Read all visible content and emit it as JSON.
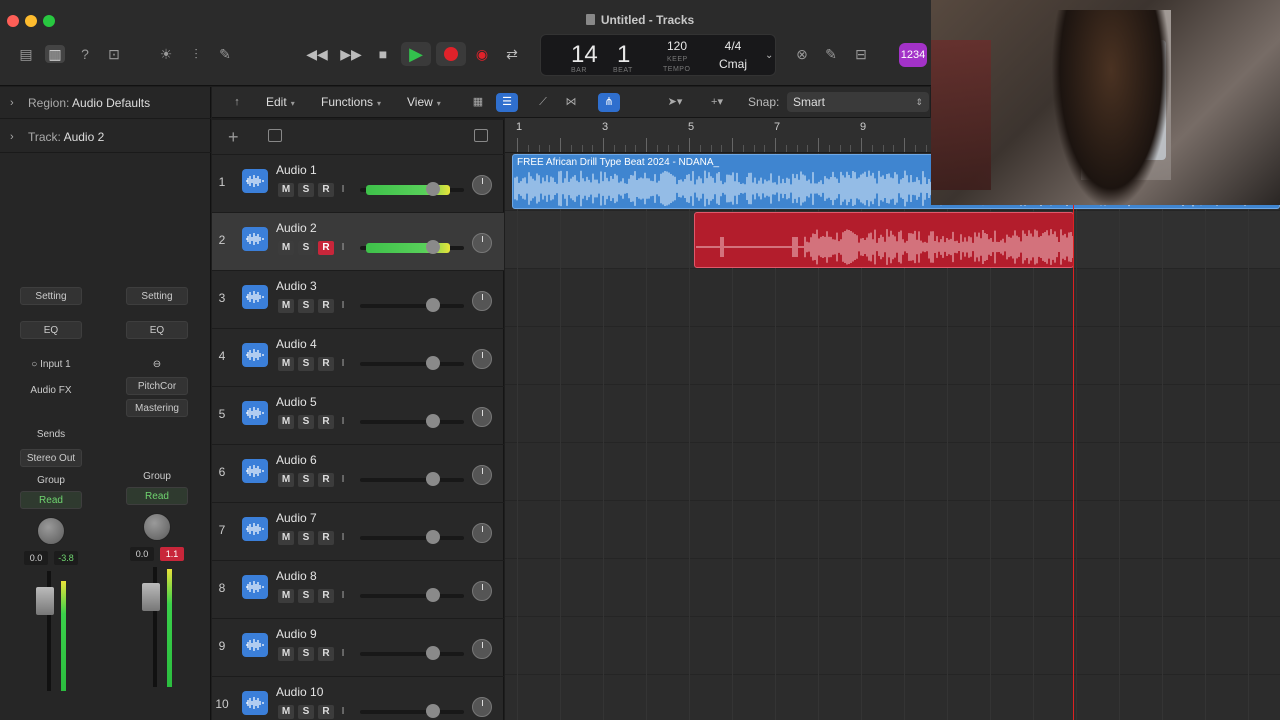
{
  "window": {
    "title": "Untitled - Tracks"
  },
  "lcd": {
    "bar": "14",
    "beat": "1",
    "bar_label": "BAR",
    "beat_label": "BEAT",
    "tempo": "120",
    "keep_label": "KEEP",
    "tempo_label": "TEMPO",
    "time_sig": "4/4",
    "key": "Cmaj"
  },
  "toolbar": {
    "badge": "1234"
  },
  "inspector": {
    "region_label": "Region:",
    "region_value": "Audio Defaults",
    "track_label": "Track:",
    "track_value": "Audio 2",
    "strip1": {
      "setting": "Setting",
      "eq": "EQ",
      "input": "Input 1",
      "audio_fx": "Audio FX",
      "sends": "Sends",
      "output": "Stereo Out",
      "group": "Group",
      "automation": "Read",
      "vol": "0.0",
      "peak": "-3.8"
    },
    "strip2": {
      "setting": "Setting",
      "eq": "EQ",
      "plugin1": "PitchCor",
      "plugin2": "Mastering",
      "group": "Group",
      "automation": "Read",
      "vol": "0.0",
      "peak": "1.1"
    }
  },
  "menubar": {
    "edit": "Edit",
    "functions": "Functions",
    "view": "View",
    "snap_label": "Snap:",
    "snap_value": "Smart"
  },
  "ruler": {
    "bars": [
      "1",
      "3",
      "5",
      "7",
      "9"
    ]
  },
  "tracks": [
    {
      "num": "1",
      "name": "Audio 1",
      "m": "M",
      "s": "S",
      "r": "R",
      "i": "I"
    },
    {
      "num": "2",
      "name": "Audio 2",
      "m": "M",
      "s": "S",
      "r": "R",
      "i": "I"
    },
    {
      "num": "3",
      "name": "Audio 3",
      "m": "M",
      "s": "S",
      "r": "R",
      "i": "I"
    },
    {
      "num": "4",
      "name": "Audio 4",
      "m": "M",
      "s": "S",
      "r": "R",
      "i": "I"
    },
    {
      "num": "5",
      "name": "Audio 5",
      "m": "M",
      "s": "S",
      "r": "R",
      "i": "I"
    },
    {
      "num": "6",
      "name": "Audio 6",
      "m": "M",
      "s": "S",
      "r": "R",
      "i": "I"
    },
    {
      "num": "7",
      "name": "Audio 7",
      "m": "M",
      "s": "S",
      "r": "R",
      "i": "I"
    },
    {
      "num": "8",
      "name": "Audio 8",
      "m": "M",
      "s": "S",
      "r": "R",
      "i": "I"
    },
    {
      "num": "9",
      "name": "Audio 9",
      "m": "M",
      "s": "S",
      "r": "R",
      "i": "I"
    },
    {
      "num": "10",
      "name": "Audio 10",
      "m": "M",
      "s": "S",
      "r": "R",
      "i": "I"
    }
  ],
  "regions": {
    "blue_name": "FREE African Drill Type Beat 2024 - NDANA_"
  },
  "colors": {
    "accent": "#2f6fce",
    "region_blue": "#3f85d0",
    "region_red": "#b31d2c",
    "record": "#e0222a",
    "play": "#33c24d"
  }
}
